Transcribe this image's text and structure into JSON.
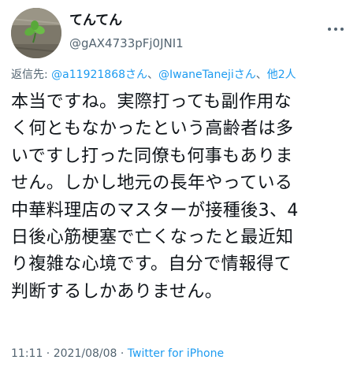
{
  "user": {
    "display_name": "てんてん",
    "handle": "@gAX4733pFj0JNI1"
  },
  "reply": {
    "prefix": "返信先: ",
    "mention_1": "@a11921868さん",
    "separator_1": "、",
    "mention_2": "@IwaneTanejiさん",
    "separator_2": "、",
    "others": "他2人"
  },
  "body": {
    "lines": [
      "本当ですね。実際打っても副作用な",
      "く何ともなかったという高齢者は多",
      "いですし打った同僚も何事もありま",
      "せん。しかし地元の長年やっている",
      "中華料理店のマスターが接種後3、4",
      "日後心筋梗塞で亡くなったと最近知",
      "り複雑な心境です。自分で情報得て",
      "判断するしかありません。"
    ]
  },
  "meta": {
    "time": "11:11",
    "dot_1": " · ",
    "date": "2021/08/08",
    "dot_2": " · ",
    "source": "Twitter for iPhone"
  },
  "icons": {
    "more": "more-horizontal-icon",
    "avatar_image": "clover-sprout-photo"
  },
  "colors": {
    "text": "#0f1419",
    "secondary": "#536471",
    "link": "#1d9bf0"
  }
}
